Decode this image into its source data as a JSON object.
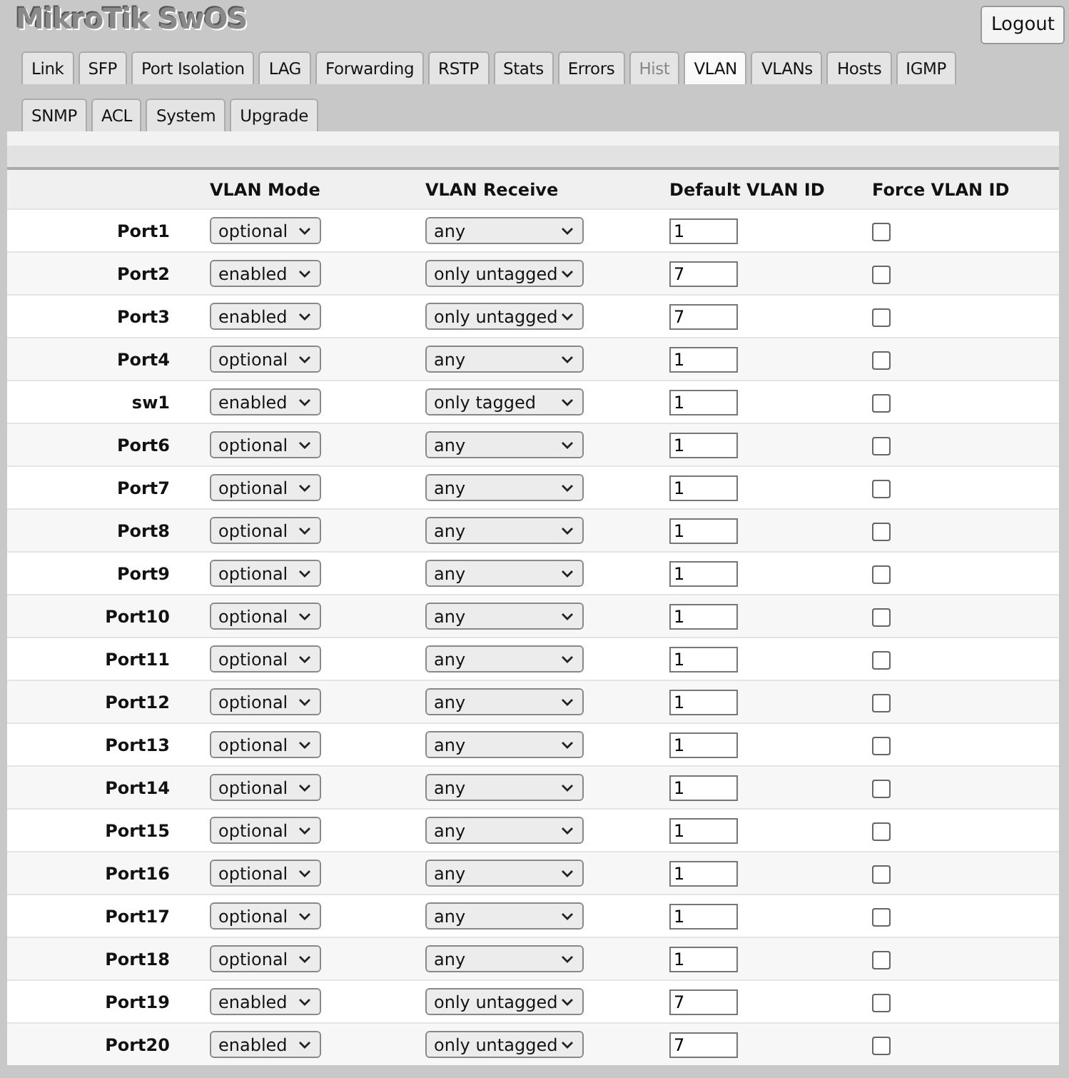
{
  "header": {
    "title": "MikroTik SwOS",
    "logout": "Logout"
  },
  "tabs": [
    {
      "label": "Link",
      "selected": false,
      "disabled": false
    },
    {
      "label": "SFP",
      "selected": false,
      "disabled": false
    },
    {
      "label": "Port Isolation",
      "selected": false,
      "disabled": false
    },
    {
      "label": "LAG",
      "selected": false,
      "disabled": false
    },
    {
      "label": "Forwarding",
      "selected": false,
      "disabled": false
    },
    {
      "label": "RSTP",
      "selected": false,
      "disabled": false
    },
    {
      "label": "Stats",
      "selected": false,
      "disabled": false
    },
    {
      "label": "Errors",
      "selected": false,
      "disabled": false
    },
    {
      "label": "Hist",
      "selected": false,
      "disabled": true
    },
    {
      "label": "VLAN",
      "selected": true,
      "disabled": false
    },
    {
      "label": "VLANs",
      "selected": false,
      "disabled": false
    },
    {
      "label": "Hosts",
      "selected": false,
      "disabled": false
    },
    {
      "label": "IGMP",
      "selected": false,
      "disabled": false
    },
    {
      "label": "SNMP",
      "selected": false,
      "disabled": false
    },
    {
      "label": "ACL",
      "selected": false,
      "disabled": false
    },
    {
      "label": "System",
      "selected": false,
      "disabled": false
    },
    {
      "label": "Upgrade",
      "selected": false,
      "disabled": false
    }
  ],
  "table": {
    "columns": [
      "VLAN Mode",
      "VLAN Receive",
      "Default VLAN ID",
      "Force VLAN ID"
    ],
    "rows": [
      {
        "port": "Port1",
        "mode": "optional",
        "receive": "any",
        "default_id": "1",
        "force": false
      },
      {
        "port": "Port2",
        "mode": "enabled",
        "receive": "only untagged",
        "default_id": "7",
        "force": false
      },
      {
        "port": "Port3",
        "mode": "enabled",
        "receive": "only untagged",
        "default_id": "7",
        "force": false
      },
      {
        "port": "Port4",
        "mode": "optional",
        "receive": "any",
        "default_id": "1",
        "force": false
      },
      {
        "port": "sw1",
        "mode": "enabled",
        "receive": "only tagged",
        "default_id": "1",
        "force": false
      },
      {
        "port": "Port6",
        "mode": "optional",
        "receive": "any",
        "default_id": "1",
        "force": false
      },
      {
        "port": "Port7",
        "mode": "optional",
        "receive": "any",
        "default_id": "1",
        "force": false
      },
      {
        "port": "Port8",
        "mode": "optional",
        "receive": "any",
        "default_id": "1",
        "force": false
      },
      {
        "port": "Port9",
        "mode": "optional",
        "receive": "any",
        "default_id": "1",
        "force": false
      },
      {
        "port": "Port10",
        "mode": "optional",
        "receive": "any",
        "default_id": "1",
        "force": false
      },
      {
        "port": "Port11",
        "mode": "optional",
        "receive": "any",
        "default_id": "1",
        "force": false
      },
      {
        "port": "Port12",
        "mode": "optional",
        "receive": "any",
        "default_id": "1",
        "force": false
      },
      {
        "port": "Port13",
        "mode": "optional",
        "receive": "any",
        "default_id": "1",
        "force": false
      },
      {
        "port": "Port14",
        "mode": "optional",
        "receive": "any",
        "default_id": "1",
        "force": false
      },
      {
        "port": "Port15",
        "mode": "optional",
        "receive": "any",
        "default_id": "1",
        "force": false
      },
      {
        "port": "Port16",
        "mode": "optional",
        "receive": "any",
        "default_id": "1",
        "force": false
      },
      {
        "port": "Port17",
        "mode": "optional",
        "receive": "any",
        "default_id": "1",
        "force": false
      },
      {
        "port": "Port18",
        "mode": "optional",
        "receive": "any",
        "default_id": "1",
        "force": false
      },
      {
        "port": "Port19",
        "mode": "enabled",
        "receive": "only untagged",
        "default_id": "7",
        "force": false
      },
      {
        "port": "Port20",
        "mode": "enabled",
        "receive": "only untagged",
        "default_id": "7",
        "force": false
      }
    ]
  }
}
